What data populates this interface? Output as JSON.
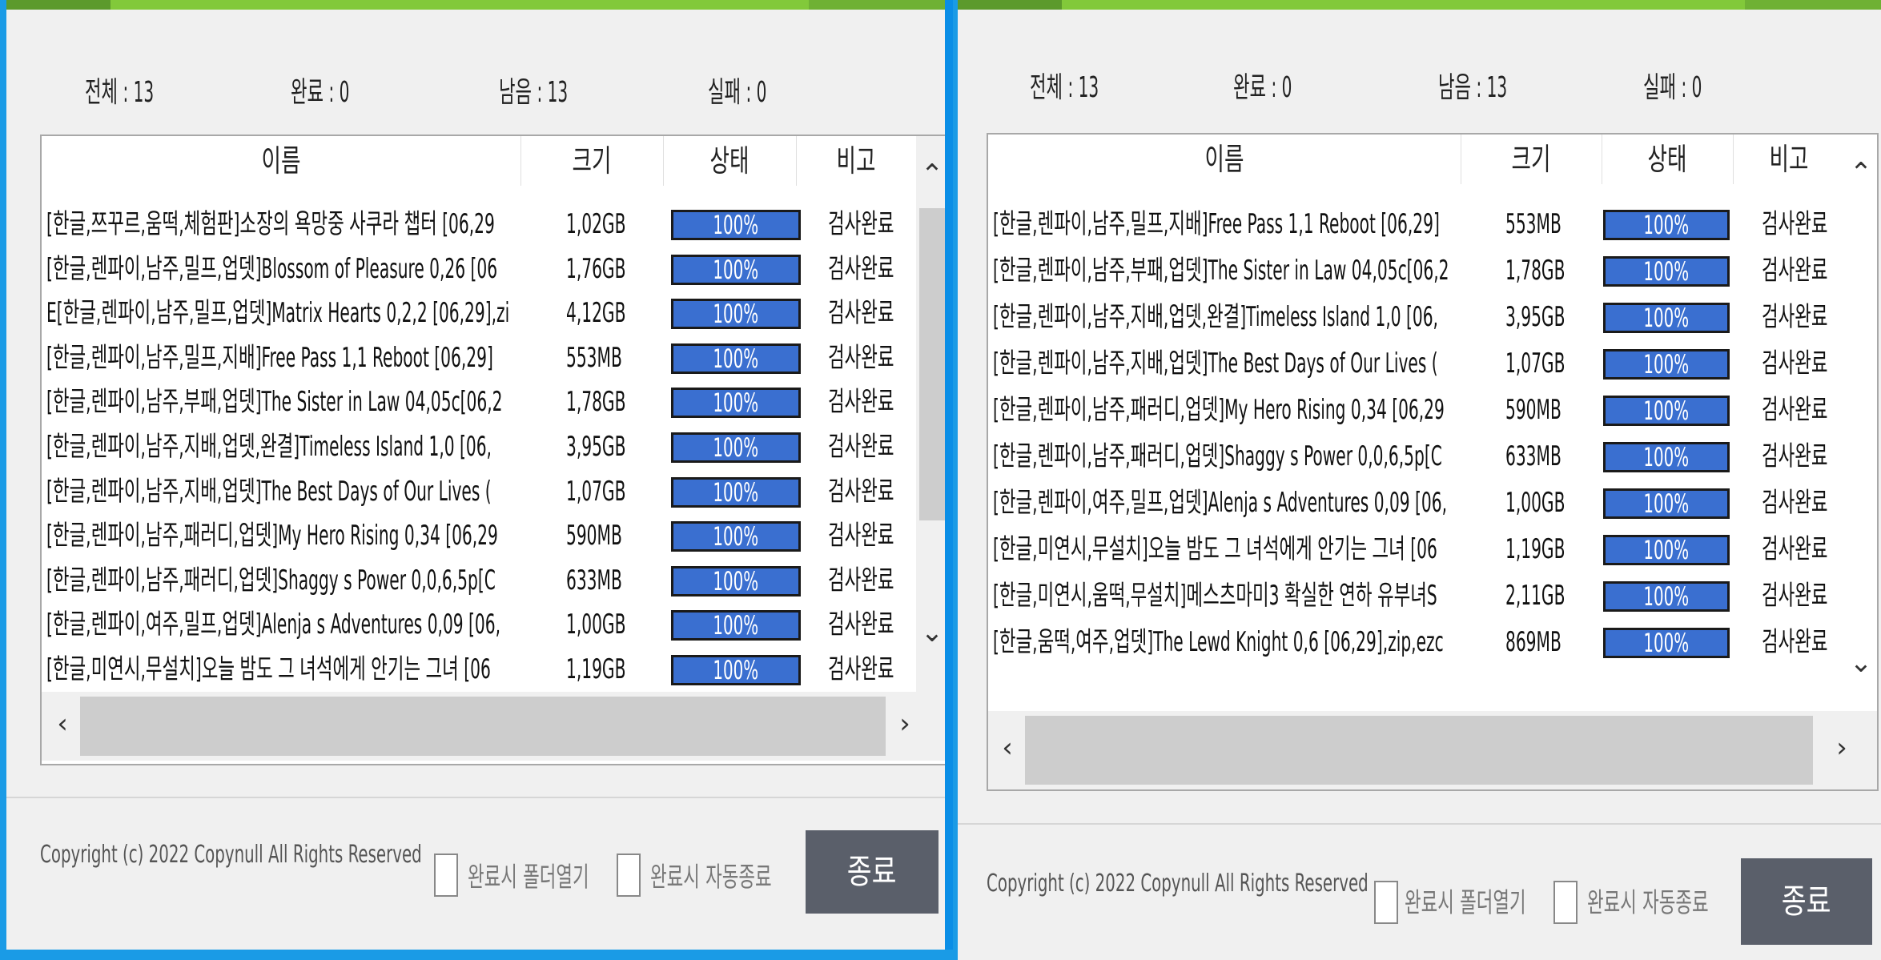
{
  "colors": {
    "accent_green": "#82c93a",
    "progress_blue": "#3a6fd0",
    "close_button": "#5a5f6a",
    "frame_blue": "#1a9be6"
  },
  "windowA": {
    "stats": {
      "total": "전체 : 13",
      "done": "완료 : 0",
      "remaining": "남음 : 13",
      "failed": "실패 : 0"
    },
    "columns": {
      "name": "이름",
      "size": "크기",
      "status": "상태",
      "note": "비고"
    },
    "rows": [
      {
        "name": "[한글,쯔꾸르,움떡,체험판]소장의 욕망중 사쿠라 챕터 [06,29",
        "size": "1,02GB",
        "progress": "100%",
        "note": "검사완료"
      },
      {
        "name": "[한글,렌파이,남주,밀프,업뎃]Blossom of Pleasure 0,26 [06",
        "size": "1,76GB",
        "progress": "100%",
        "note": "검사완료"
      },
      {
        "name": "E[한글,렌파이,남주,밀프,업뎃]Matrix Hearts 0,2,2 [06,29],zi",
        "size": "4,12GB",
        "progress": "100%",
        "note": "검사완료"
      },
      {
        "name": "[한글,렌파이,남주,밀프,지배]Free Pass 1,1 Reboot [06,29]",
        "size": "553MB",
        "progress": "100%",
        "note": "검사완료"
      },
      {
        "name": "[한글,렌파이,남주,부패,업뎃]The Sister in Law 04,05c[06,2",
        "size": "1,78GB",
        "progress": "100%",
        "note": "검사완료"
      },
      {
        "name": "[한글,렌파이,남주,지배,업뎃,완결]Timeless Island 1,0 [06,",
        "size": "3,95GB",
        "progress": "100%",
        "note": "검사완료"
      },
      {
        "name": "[한글,렌파이,남주,지배,업뎃]The Best Days of Our Lives (",
        "size": "1,07GB",
        "progress": "100%",
        "note": "검사완료"
      },
      {
        "name": "[한글,렌파이,남주,패러디,업뎃]My Hero Rising 0,34 [06,29",
        "size": "590MB",
        "progress": "100%",
        "note": "검사완료"
      },
      {
        "name": "[한글,렌파이,남주,패러디,업뎃]Shaggy s Power 0,0,6,5p[C",
        "size": "633MB",
        "progress": "100%",
        "note": "검사완료"
      },
      {
        "name": "[한글,렌파이,여주,밀프,업뎃]Alenja s Adventures 0,09 [06,",
        "size": "1,00GB",
        "progress": "100%",
        "note": "검사완료"
      },
      {
        "name": "[한글,미연시,무설치]오늘 밤도 그 녀석에게 안기는 그녀 [06",
        "size": "1,19GB",
        "progress": "100%",
        "note": "검사완료"
      }
    ],
    "footer": {
      "copyright": "Copyright (c) 2022 Copynull All Rights Reserved",
      "open_folder": "완료시 폴더열기",
      "auto_close": "완료시 자동종료",
      "close": "종료"
    }
  },
  "windowB": {
    "stats": {
      "total": "전체 : 13",
      "done": "완료 : 0",
      "remaining": "남음 : 13",
      "failed": "실패 : 0"
    },
    "columns": {
      "name": "이름",
      "size": "크기",
      "status": "상태",
      "note": "비고"
    },
    "rows": [
      {
        "name": "[한글,렌파이,남주,밀프,지배]Free Pass 1,1 Reboot [06,29]",
        "size": "553MB",
        "progress": "100%",
        "note": "검사완료"
      },
      {
        "name": "[한글,렌파이,남주,부패,업뎃]The Sister in Law 04,05c[06,2",
        "size": "1,78GB",
        "progress": "100%",
        "note": "검사완료"
      },
      {
        "name": "[한글,렌파이,남주,지배,업뎃,완결]Timeless Island 1,0 [06,",
        "size": "3,95GB",
        "progress": "100%",
        "note": "검사완료"
      },
      {
        "name": "[한글,렌파이,남주,지배,업뎃]The Best Days of Our Lives (",
        "size": "1,07GB",
        "progress": "100%",
        "note": "검사완료"
      },
      {
        "name": "[한글,렌파이,남주,패러디,업뎃]My Hero Rising 0,34 [06,29",
        "size": "590MB",
        "progress": "100%",
        "note": "검사완료"
      },
      {
        "name": "[한글,렌파이,남주,패러디,업뎃]Shaggy s Power 0,0,6,5p[C",
        "size": "633MB",
        "progress": "100%",
        "note": "검사완료"
      },
      {
        "name": "[한글,렌파이,여주,밀프,업뎃]Alenja s Adventures 0,09 [06,",
        "size": "1,00GB",
        "progress": "100%",
        "note": "검사완료"
      },
      {
        "name": "[한글,미연시,무설치]오늘 밤도 그 녀석에게 안기는 그녀 [06",
        "size": "1,19GB",
        "progress": "100%",
        "note": "검사완료"
      },
      {
        "name": "[한글,미연시,움떡,무설치]메스츠마미3 확실한 연하 유부녀S",
        "size": "2,11GB",
        "progress": "100%",
        "note": "검사완료"
      },
      {
        "name": "[한글,움떡,여주,업뎃]The Lewd Knight 0,6 [06,29],zip,ezc",
        "size": "869MB",
        "progress": "100%",
        "note": "검사완료"
      }
    ],
    "footer": {
      "copyright": "Copyright (c) 2022 Copynull All Rights Reserved",
      "open_folder": "완료시 폴더열기",
      "auto_close": "완료시 자동종료",
      "close": "종료"
    }
  }
}
